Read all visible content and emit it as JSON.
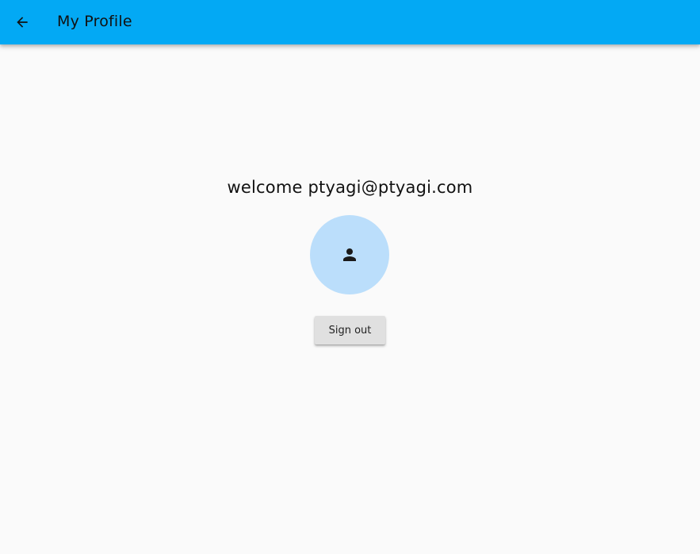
{
  "app_bar": {
    "title": "My Profile",
    "back_icon": "arrow-back-icon",
    "color": "#03a9f4"
  },
  "profile": {
    "welcome_text": "welcome ptyagi@ptyagi.com",
    "avatar_icon": "person-icon",
    "avatar_color": "#bbdefb"
  },
  "actions": {
    "sign_out_label": "Sign out"
  }
}
